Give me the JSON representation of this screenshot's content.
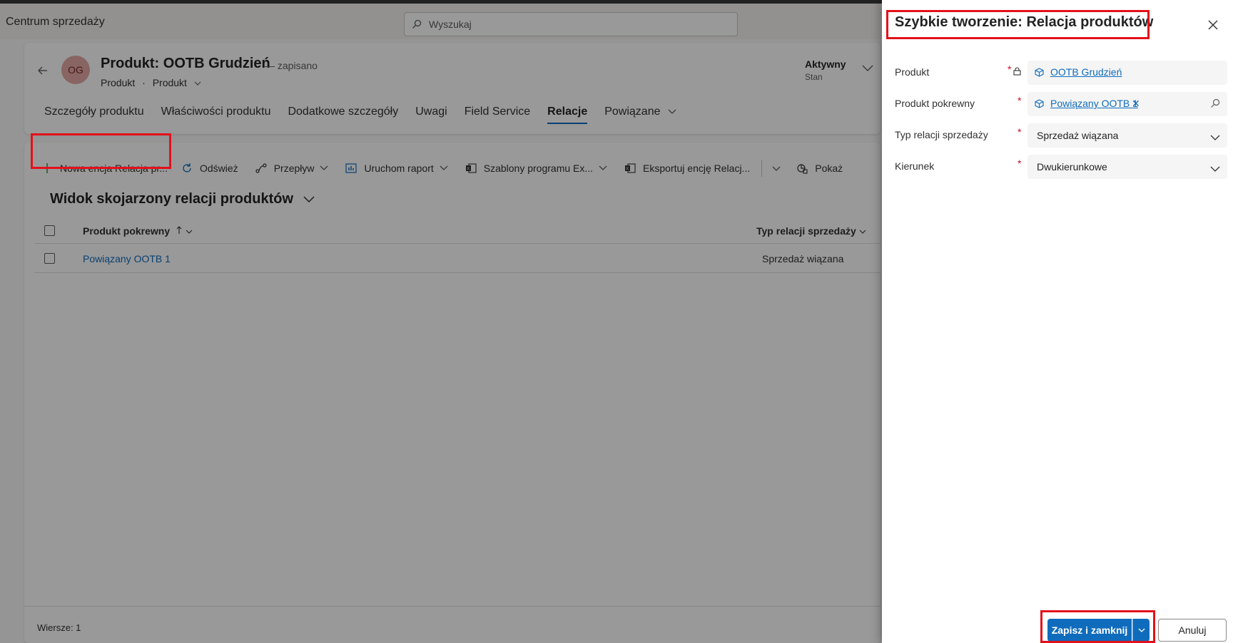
{
  "app": {
    "name": "Centrum sprzedaży",
    "search_placeholder": "Wyszukaj"
  },
  "record": {
    "avatar_initials": "OG",
    "title": "Produkt: OOTB Grudzień",
    "saved_status": "— zapisano",
    "entity": "Produkt",
    "form_selector": "Produkt",
    "status_value": "Aktywny",
    "status_label": "Stan",
    "tabs": [
      "Szczegóły produktu",
      "Właściwości produktu",
      "Dodatkowe szczegóły",
      "Uwagi",
      "Field Service",
      "Relacje",
      "Powiązane"
    ],
    "active_tab": "Relacje"
  },
  "commandbar": {
    "new_label": "Nowa encja Relacja pr...",
    "refresh_label": "Odśwież",
    "flow_label": "Przepływ",
    "report_label": "Uruchom raport",
    "excel_templates_label": "Szablony programu Ex...",
    "export_label": "Eksportuj encję Relacj...",
    "show_label": "Pokaż"
  },
  "view": {
    "title": "Widok skojarzony relacji produktów",
    "columns": [
      "Produkt pokrewny",
      "Typ relacji sprzedaży"
    ],
    "rows": [
      {
        "related_product": "Powiązany OOTB 1",
        "sales_relationship_type": "Sprzedaż wiązana"
      }
    ],
    "row_count_label": "Wiersze: 1"
  },
  "quick_create": {
    "title": "Szybkie tworzenie: Relacja produktów",
    "fields": [
      {
        "label": "Produkt",
        "required": "*",
        "value": "OOTB Grudzień"
      },
      {
        "label": "Produkt pokrewny",
        "required": "*",
        "value": "Powiązany OOTB 1"
      },
      {
        "label": "Typ relacji sprzedaży",
        "required": "*",
        "value": "Sprzedaż wiązana"
      },
      {
        "label": "Kierunek",
        "required": "*",
        "value": "Dwukierunkowe"
      }
    ],
    "save_close_label": "Zapisz i zamknij",
    "cancel_label": "Anuluj"
  },
  "colors": {
    "accent": "#0f6cbd",
    "highlight": "#e3111b",
    "required": "#c50f1f"
  }
}
